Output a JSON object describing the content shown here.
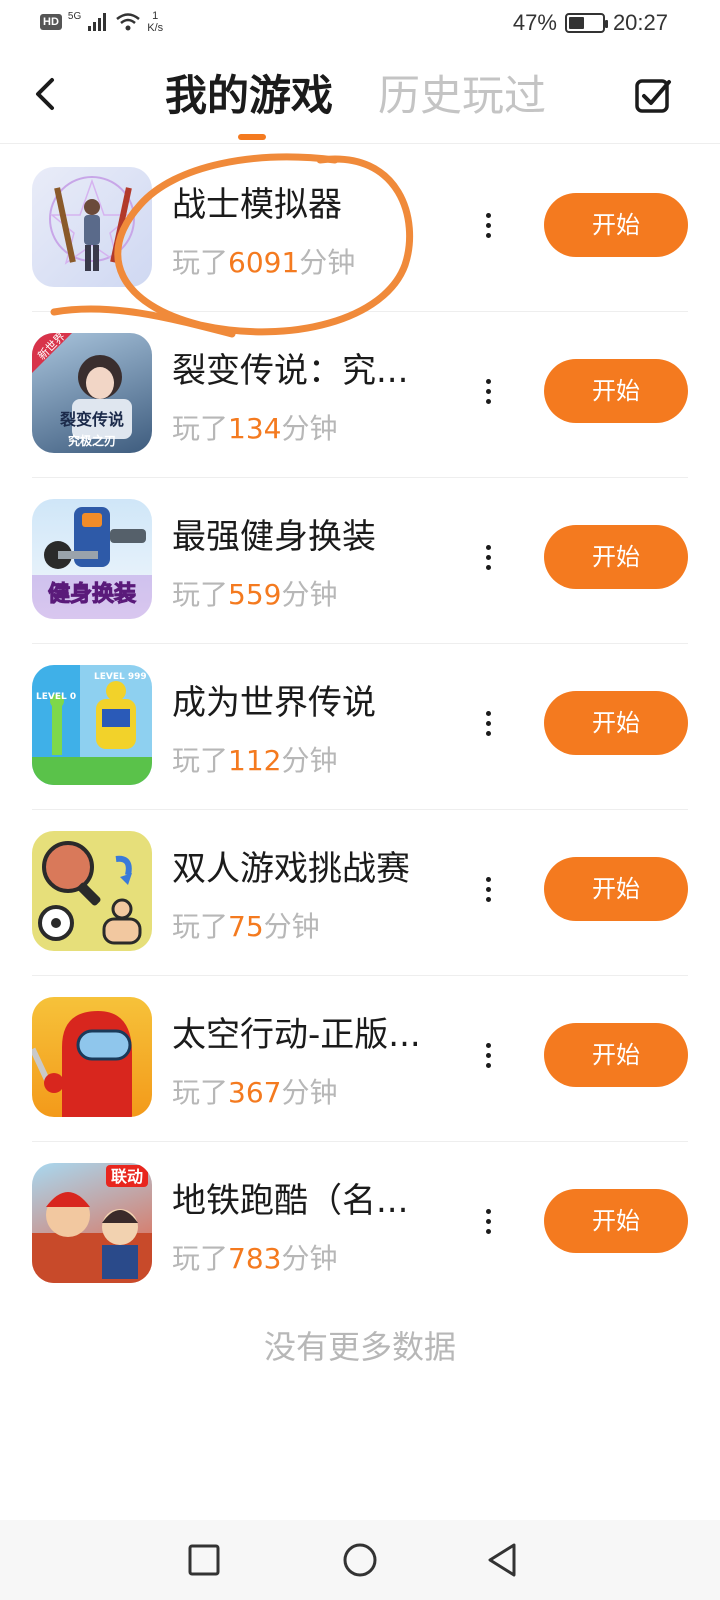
{
  "status_bar": {
    "hd": "HD",
    "network": "5G",
    "speed_value": "1",
    "speed_unit": "K/s",
    "battery_percent": "47%",
    "battery_level": 0.47,
    "time": "20:27"
  },
  "header": {
    "tab_active": "我的游戏",
    "tab_inactive": "历史玩过",
    "back_icon": "chevron-left-icon",
    "edit_icon": "checkbox-edit-icon"
  },
  "games": [
    {
      "name": "战士模拟器",
      "played_prefix": "玩了",
      "minutes": "6091",
      "unit": "分钟",
      "button": "开始"
    },
    {
      "name": "裂变传说：究...",
      "played_prefix": "玩了",
      "minutes": "134",
      "unit": "分钟",
      "button": "开始",
      "icon_badge": "新世界",
      "icon_title": "裂变传说",
      "icon_subtitle": "究极之刃"
    },
    {
      "name": "最强健身换装",
      "played_prefix": "玩了",
      "minutes": "559",
      "unit": "分钟",
      "button": "开始",
      "icon_title": "健身换装"
    },
    {
      "name": "成为世界传说",
      "played_prefix": "玩了",
      "minutes": "112",
      "unit": "分钟",
      "button": "开始",
      "icon_level_left": "LEVEL 0",
      "icon_level_right": "LEVEL 999"
    },
    {
      "name": "双人游戏挑战赛",
      "played_prefix": "玩了",
      "minutes": "75",
      "unit": "分钟",
      "button": "开始"
    },
    {
      "name": "太空行动-正版...",
      "played_prefix": "玩了",
      "minutes": "367",
      "unit": "分钟",
      "button": "开始"
    },
    {
      "name": "地铁跑酷（名...",
      "played_prefix": "玩了",
      "minutes": "783",
      "unit": "分钟",
      "button": "开始",
      "icon_badge": "联动"
    }
  ],
  "footer_text": "没有更多数据",
  "colors": {
    "accent": "#f47a1f",
    "muted": "#b7b7b7",
    "annotation": "#f08a3a"
  },
  "nav": {
    "recent": "square-icon",
    "home": "circle-icon",
    "back": "triangle-back-icon"
  }
}
